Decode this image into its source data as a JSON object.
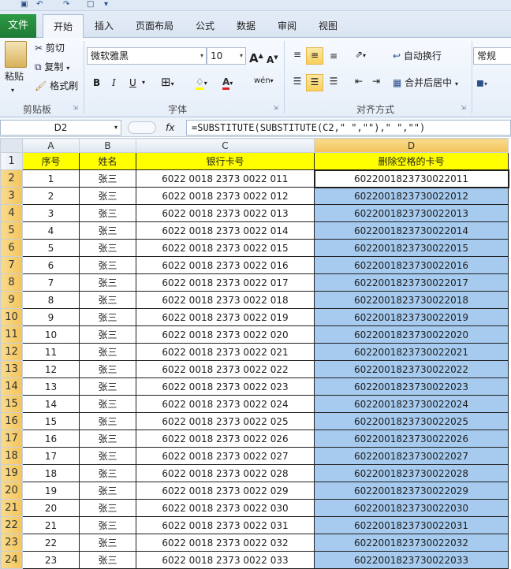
{
  "ribbon_tabs": [
    "文件",
    "开始",
    "插入",
    "页面布局",
    "公式",
    "数据",
    "审阅",
    "视图"
  ],
  "active_tab": "开始",
  "clipboard": {
    "paste": "粘贴",
    "cut": "剪切",
    "copy": "复制",
    "format_painter": "格式刷",
    "label": "剪贴板"
  },
  "font": {
    "name": "微软雅黑",
    "size": "10",
    "label": "字体",
    "bold": "B",
    "italic": "I",
    "underline": "U",
    "grow": "A",
    "shrink": "A",
    "phonetic": "wén"
  },
  "alignment": {
    "wrap_text": "自动换行",
    "merge_center": "合并后居中",
    "label": "对齐方式"
  },
  "number": {
    "format": "常规"
  },
  "formula_bar": {
    "name_box": "D2",
    "fx": "fx",
    "formula": "=SUBSTITUTE(SUBSTITUTE(C2,\" \",\"\"),\" \",\"\")"
  },
  "sheet": {
    "columns": [
      "A",
      "B",
      "C",
      "D"
    ],
    "headers": [
      "序号",
      "姓名",
      "银行卡号",
      "删除空格的卡号"
    ],
    "rows": [
      [
        "1",
        "张三",
        "6022 0018 2373 0022 011",
        "6022001823730022011"
      ],
      [
        "2",
        "张三",
        "6022 0018 2373 0022 012",
        "6022001823730022012"
      ],
      [
        "3",
        "张三",
        "6022 0018 2373 0022 013",
        "6022001823730022013"
      ],
      [
        "4",
        "张三",
        "6022 0018 2373 0022 014",
        "6022001823730022014"
      ],
      [
        "5",
        "张三",
        "6022 0018 2373 0022 015",
        "6022001823730022015"
      ],
      [
        "6",
        "张三",
        "6022 0018 2373 0022 016",
        "6022001823730022016"
      ],
      [
        "7",
        "张三",
        "6022 0018 2373 0022 017",
        "6022001823730022017"
      ],
      [
        "8",
        "张三",
        "6022 0018 2373 0022 018",
        "6022001823730022018"
      ],
      [
        "9",
        "张三",
        "6022 0018 2373 0022 019",
        "6022001823730022019"
      ],
      [
        "10",
        "张三",
        "6022 0018 2373 0022 020",
        "6022001823730022020"
      ],
      [
        "11",
        "张三",
        "6022 0018 2373 0022 021",
        "6022001823730022021"
      ],
      [
        "12",
        "张三",
        "6022 0018 2373 0022 022",
        "6022001823730022022"
      ],
      [
        "13",
        "张三",
        "6022 0018 2373 0022 023",
        "6022001823730022023"
      ],
      [
        "14",
        "张三",
        "6022 0018 2373 0022 024",
        "6022001823730022024"
      ],
      [
        "15",
        "张三",
        "6022 0018 2373 0022 025",
        "6022001823730022025"
      ],
      [
        "16",
        "张三",
        "6022 0018 2373 0022 026",
        "6022001823730022026"
      ],
      [
        "17",
        "张三",
        "6022 0018 2373 0022 027",
        "6022001823730022027"
      ],
      [
        "18",
        "张三",
        "6022 0018 2373 0022 028",
        "6022001823730022028"
      ],
      [
        "19",
        "张三",
        "6022 0018 2373 0022 029",
        "6022001823730022029"
      ],
      [
        "20",
        "张三",
        "6022 0018 2373 0022 030",
        "6022001823730022030"
      ],
      [
        "21",
        "张三",
        "6022 0018 2373 0022 031",
        "6022001823730022031"
      ],
      [
        "22",
        "张三",
        "6022 0018 2373 0022 032",
        "6022001823730022032"
      ],
      [
        "23",
        "张三",
        "6022 0018 2373 0022 033",
        "6022001823730022033"
      ]
    ]
  },
  "colors": {
    "header_fill": "#ffff00",
    "selection_fill": "#a6cbef",
    "file_tab": "#2c9a45"
  }
}
